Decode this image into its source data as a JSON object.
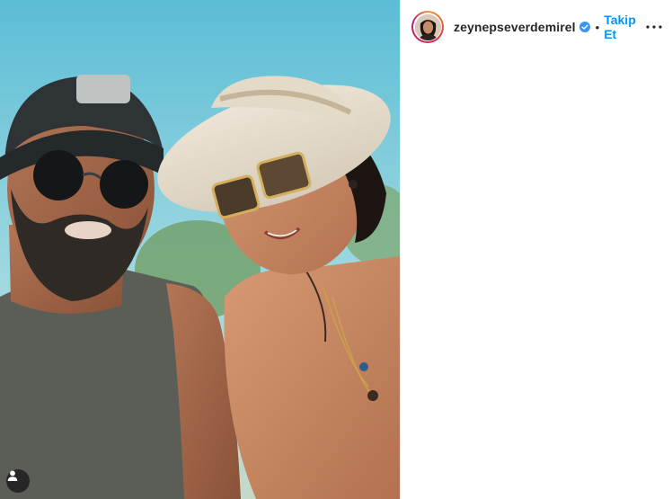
{
  "post": {
    "author": {
      "username": "zeynepseverdemirel",
      "verified": true,
      "avatar_icon": "profile-avatar"
    },
    "separator": "•",
    "follow_label": "Takip Et",
    "more_icon": "more-options-icon",
    "tag_icon": "user-tag-icon"
  },
  "colors": {
    "follow_blue": "#0095f6",
    "text_dark": "#262626",
    "verified_blue": "#3897f0"
  }
}
